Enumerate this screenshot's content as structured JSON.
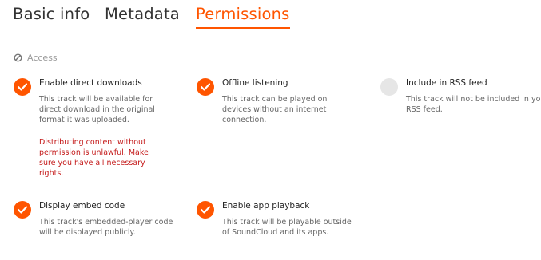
{
  "tabs": [
    {
      "label": "Basic info",
      "active": false
    },
    {
      "label": "Metadata",
      "active": false
    },
    {
      "label": "Permissions",
      "active": true
    }
  ],
  "section": {
    "label": "Access",
    "icon": "blocked-icon"
  },
  "permissions": [
    {
      "title": "Enable direct downloads",
      "checked": true,
      "description": "This track will be available for direct download in the original format it was uploaded.",
      "warning": "Distributing content without permission is unlawful. Make sure you have all necessary rights."
    },
    {
      "title": "Offline listening",
      "checked": true,
      "description": "This track can be played on devices without an internet connection."
    },
    {
      "title": "Include in RSS feed",
      "checked": false,
      "description": "This track will not be included in your RSS feed."
    },
    {
      "title": "Display embed code",
      "checked": true,
      "description": "This track's embedded-player code will be displayed publicly."
    },
    {
      "title": "Enable app playback",
      "checked": true,
      "description": "This track will be playable outside of SoundCloud and its apps."
    }
  ],
  "colors": {
    "accent": "#ff5500",
    "warning": "#c41a1a",
    "unchecked": "#e6e6e6"
  }
}
